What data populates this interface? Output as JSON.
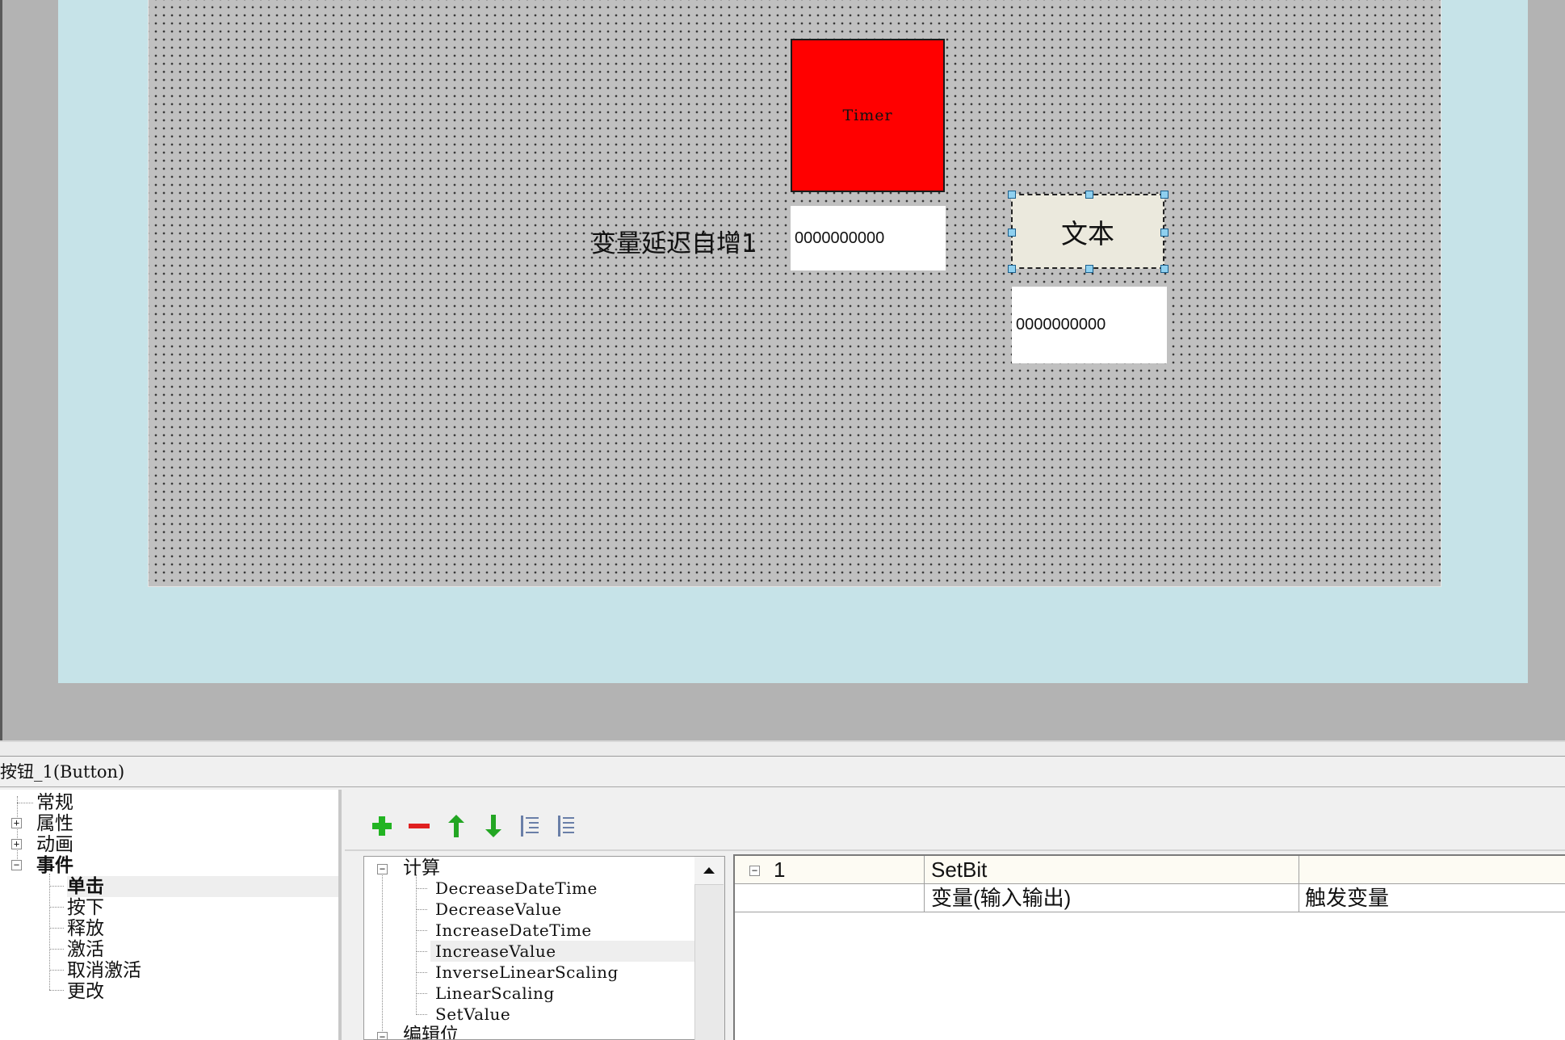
{
  "canvas": {
    "timer_label": "Timer",
    "variable_label": "变量延迟自增1",
    "io_field_1_value": "0000000000",
    "io_field_2_value": "0000000000",
    "text_button_label": "文本"
  },
  "inspector": {
    "title": "按钮_1(Button)",
    "categories": [
      {
        "label": "常规"
      },
      {
        "label": "属性",
        "expander": "+"
      },
      {
        "label": "动画",
        "expander": "+"
      },
      {
        "label": "事件",
        "expander": "−"
      }
    ],
    "events": [
      {
        "label": "单击"
      },
      {
        "label": "按下"
      },
      {
        "label": "释放"
      },
      {
        "label": "激活"
      },
      {
        "label": "取消激活"
      },
      {
        "label": "更改"
      }
    ],
    "toolbar": {
      "icons": [
        "add-icon",
        "remove-icon",
        "move-up-icon",
        "move-down-icon",
        "indent-icon",
        "outdent-icon"
      ]
    },
    "function_list": {
      "category_1": "计算",
      "category_1_expander": "−",
      "items": [
        "DecreaseDateTime",
        "DecreaseValue",
        "IncreaseDateTime",
        "IncreaseValue",
        "InverseLinearScaling",
        "LinearScaling",
        "SetValue"
      ],
      "category_2": "编辑位",
      "category_2_expander": "−"
    },
    "event_grid": {
      "row_1": {
        "expander": "−",
        "index": "1",
        "function": "SetBit",
        "value": ""
      },
      "row_2": {
        "index": "",
        "param_name": "变量(输入输出)",
        "param_value": "触发变量"
      }
    }
  },
  "colors": {
    "canvas_bg": "#c0c0c0",
    "screen_bg": "#c6e3e8",
    "timer_fill": "#ff0000",
    "handle_fill": "#8fd0ef",
    "add_icon": "#22b422",
    "remove_icon": "#e02020",
    "arrow_icon": "#23a623"
  }
}
